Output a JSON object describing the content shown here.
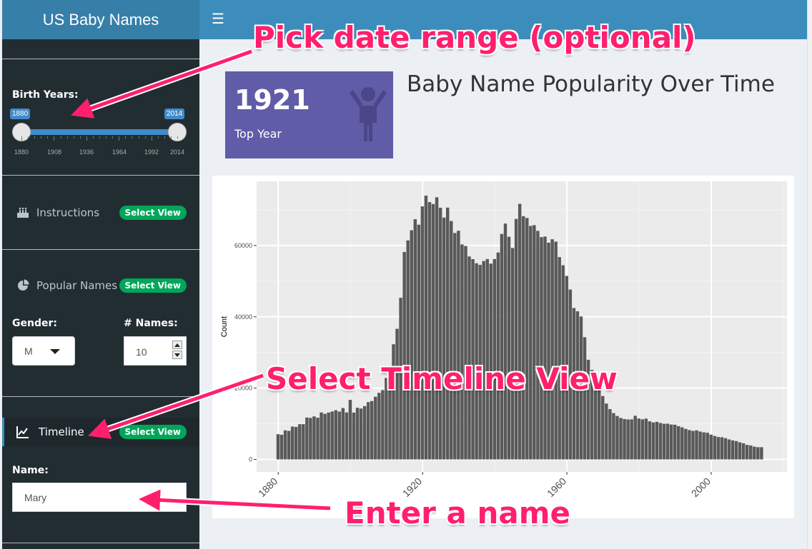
{
  "header": {
    "app_title": "US Baby Names",
    "menu_icon": "hamburger-icon"
  },
  "sidebar": {
    "birth_years": {
      "label": "Birth Years:",
      "min": 1880,
      "max": 2014,
      "value_from": "1880",
      "value_to": "2014",
      "tick_labels": [
        "1880",
        "1908",
        "1936",
        "1964",
        "1992",
        "2014"
      ]
    },
    "menu": [
      {
        "label": "Instructions",
        "icon": "birthday-cake-icon",
        "badge": "Select View"
      },
      {
        "label": "Popular Names",
        "icon": "pie-chart-icon",
        "badge": "Select View"
      },
      {
        "label": "Timeline",
        "icon": "line-chart-icon",
        "badge": "Select View",
        "active": true
      }
    ],
    "gender": {
      "label": "Gender:",
      "value": "M"
    },
    "num_names": {
      "label": "# Names:",
      "value": "10"
    },
    "name": {
      "label": "Name:",
      "value": "Mary"
    }
  },
  "main": {
    "value_box": {
      "value": "1921",
      "subtitle": "Top Year",
      "icon": "child-icon",
      "color": "#605ca8"
    },
    "title": "Baby Name Popularity Over Time"
  },
  "annotations": {
    "date_range": "Pick date range (optional)",
    "timeline": "Select Timeline View",
    "name": "Enter a name"
  },
  "colors": {
    "header": "#3c8dbc",
    "logo": "#367fa9",
    "sidebar": "#222d32",
    "badge": "#00a65a",
    "bar": "#595959",
    "annotation": "#ff1f6d"
  },
  "chart_data": {
    "type": "bar",
    "xlabel": "",
    "ylabel": "Count",
    "xlim": [
      1874,
      2021
    ],
    "ylim": [
      -3500,
      78000
    ],
    "x_ticks": [
      1880,
      1920,
      1960,
      2000
    ],
    "y_ticks": [
      0,
      20000,
      40000,
      60000
    ],
    "y_tick_labels": [
      "0",
      "20000",
      "40000",
      "60000"
    ],
    "grid": true,
    "background": "#ebebeb",
    "x": [
      1880,
      1881,
      1882,
      1883,
      1884,
      1885,
      1886,
      1887,
      1888,
      1889,
      1890,
      1891,
      1892,
      1893,
      1894,
      1895,
      1896,
      1897,
      1898,
      1899,
      1900,
      1901,
      1902,
      1903,
      1904,
      1905,
      1906,
      1907,
      1908,
      1909,
      1910,
      1911,
      1912,
      1913,
      1914,
      1915,
      1916,
      1917,
      1918,
      1919,
      1920,
      1921,
      1922,
      1923,
      1924,
      1925,
      1926,
      1927,
      1928,
      1929,
      1930,
      1931,
      1932,
      1933,
      1934,
      1935,
      1936,
      1937,
      1938,
      1939,
      1940,
      1941,
      1942,
      1943,
      1944,
      1945,
      1946,
      1947,
      1948,
      1949,
      1950,
      1951,
      1952,
      1953,
      1954,
      1955,
      1956,
      1957,
      1958,
      1959,
      1960,
      1961,
      1962,
      1963,
      1964,
      1965,
      1966,
      1967,
      1968,
      1969,
      1970,
      1971,
      1972,
      1973,
      1974,
      1975,
      1976,
      1977,
      1978,
      1979,
      1980,
      1981,
      1982,
      1983,
      1984,
      1985,
      1986,
      1987,
      1988,
      1989,
      1990,
      1991,
      1992,
      1993,
      1994,
      1995,
      1996,
      1997,
      1998,
      1999,
      2000,
      2001,
      2002,
      2003,
      2004,
      2005,
      2006,
      2007,
      2008,
      2009,
      2010,
      2011,
      2012,
      2013,
      2014
    ],
    "values": [
      7065,
      6919,
      8148,
      8012,
      9217,
      9128,
      9889,
      9888,
      11754,
      11648,
      12078,
      11703,
      13172,
      12784,
      13151,
      13446,
      13811,
      13413,
      14406,
      13172,
      16707,
      13136,
      14486,
      14275,
      14962,
      16067,
      16370,
      17580,
      18665,
      19435,
      22848,
      24390,
      32304,
      36642,
      45345,
      58187,
      61438,
      64281,
      67366,
      65838,
      70980,
      73985,
      72176,
      71635,
      73536,
      70590,
      67829,
      70636,
      66868,
      63510,
      64146,
      60296,
      59872,
      56925,
      56165,
      55020,
      54574,
      55644,
      56208,
      54905,
      56200,
      58040,
      63248,
      66166,
      62463,
      59288,
      67462,
      71683,
      68228,
      67725,
      65486,
      65706,
      64101,
      62341,
      62520,
      60796,
      61757,
      61096,
      56750,
      54472,
      51474,
      47659,
      42466,
      41549,
      40098,
      34271,
      27955,
      25073,
      21790,
      20001,
      17777,
      15680,
      14113,
      12997,
      12187,
      11637,
      11325,
      11212,
      11225,
      12236,
      11474,
      11246,
      11451,
      10688,
      10373,
      10534,
      10206,
      9996,
      10018,
      9786,
      9734,
      9329,
      8990,
      8568,
      8233,
      7999,
      8153,
      7822,
      7600,
      7476,
      6955,
      6591,
      6296,
      6225,
      5985,
      5608,
      5337,
      5145,
      4801,
      4529,
      4085,
      3908,
      3582,
      3438,
      3425
    ]
  }
}
